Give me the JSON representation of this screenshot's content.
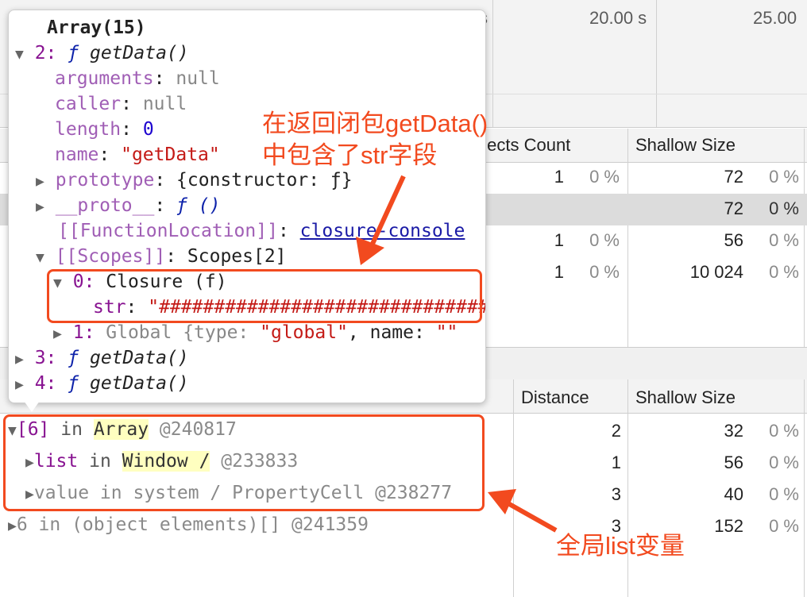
{
  "timeline": {
    "ticks": [
      "s",
      "20.00 s",
      "25.00"
    ]
  },
  "constructors_table": {
    "headers": [
      "bjects Count",
      "Shallow Size"
    ],
    "rows": [
      {
        "count": "1",
        "count_pct": "0 %",
        "size": "72",
        "size_pct": "0 %"
      },
      {
        "count": "",
        "count_pct": "",
        "size": "72",
        "size_pct": "0 %"
      },
      {
        "count": "1",
        "count_pct": "0 %",
        "size": "56",
        "size_pct": "0 %"
      },
      {
        "count": "1",
        "count_pct": "0 %",
        "size": "10 024",
        "size_pct": "0 %"
      }
    ]
  },
  "retainers_table": {
    "headers": [
      "Distance",
      "Shallow Size"
    ],
    "rows": [
      {
        "index": "[6]",
        "in": "in",
        "owner": "Array",
        "id": "@240817",
        "distance": "2",
        "size": "32",
        "pct": "0 %"
      },
      {
        "prop": "list",
        "in": "in",
        "owner": "Window /",
        "id": "@233833",
        "distance": "1",
        "size": "56",
        "pct": "0 %"
      },
      {
        "text": "value in system / PropertyCell @238277",
        "distance": "3",
        "size": "40",
        "pct": "0 %"
      },
      {
        "text": "6 in (object elements)[] @241359",
        "distance": "3",
        "size": "152",
        "pct": "0 %"
      }
    ]
  },
  "popover": {
    "title": "Array(15)",
    "lines": {
      "item2_key": "2:",
      "f": "ƒ",
      "getData": "getData()",
      "arguments_key": "arguments",
      "arguments_val": "null",
      "caller_key": "caller",
      "caller_val": "null",
      "length_key": "length",
      "length_val": "0",
      "name_key": "name",
      "name_val": "\"getData\"",
      "prototype_key": "prototype",
      "prototype_val": "{constructor: ƒ}",
      "proto_key": "__proto__",
      "proto_val": "ƒ ()",
      "funcloc_key": "[[FunctionLocation]]",
      "funcloc_val": "closure-console",
      "scopes_key": "[[Scopes]]",
      "scopes_val": "Scopes[2]",
      "closure_key": "0:",
      "closure_val": "Closure (f)",
      "str_key": "str",
      "str_val": "\"##################################",
      "global_key": "1:",
      "global_val": "Global {type: ",
      "global_type": "\"global\"",
      "global_name_key": ", name: ",
      "global_name_val": "\"\"",
      "item3_key": "3:",
      "item4_key": "4:"
    }
  },
  "annotations": {
    "closure_note_1": "在返回闭包getData()",
    "closure_note_2": "中包含了str字段",
    "global_note": "全局list变量"
  }
}
